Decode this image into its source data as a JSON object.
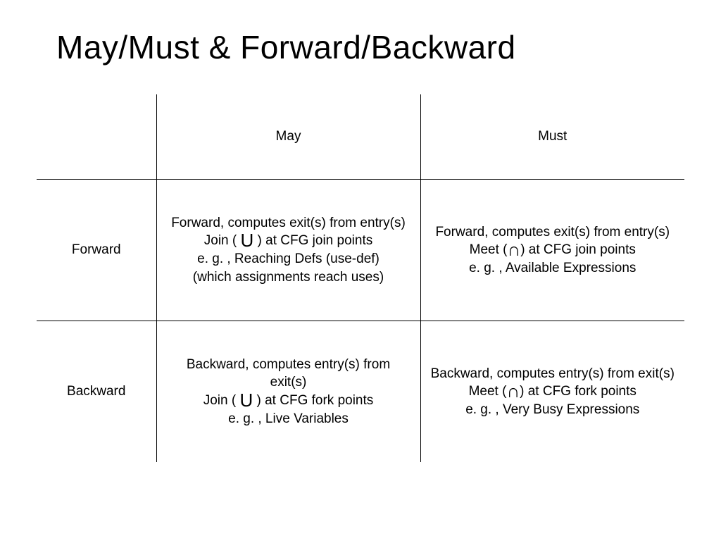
{
  "title": "May/Must & Forward/Backward",
  "col_may": "May",
  "col_must": "Must",
  "row_forward": "Forward",
  "row_backward": "Backward",
  "union": "U",
  "inter": "∩",
  "cells": {
    "fm": {
      "l1": "Forward, computes exit(s) from entry(s)",
      "l2a": "Join ( ",
      "l2b": " ) at CFG join points",
      "l3": "e. g. , Reaching Defs (use-def)",
      "l4": "(which assignments reach uses)"
    },
    "fM": {
      "l1": "Forward, computes exit(s) from entry(s)",
      "l2a": "Meet (",
      "l2b": ") at CFG join points",
      "l3": "e. g. , Available Expressions"
    },
    "bm": {
      "l1": "Backward, computes entry(s) from exit(s)",
      "l2a": "Join ( ",
      "l2b": " ) at CFG fork points",
      "l3": "e. g. , Live Variables"
    },
    "bM": {
      "l1": "Backward, computes entry(s) from exit(s)",
      "l2a": "Meet (",
      "l2b": ") at CFG fork points",
      "l3": "e. g. , Very Busy Expressions"
    }
  }
}
